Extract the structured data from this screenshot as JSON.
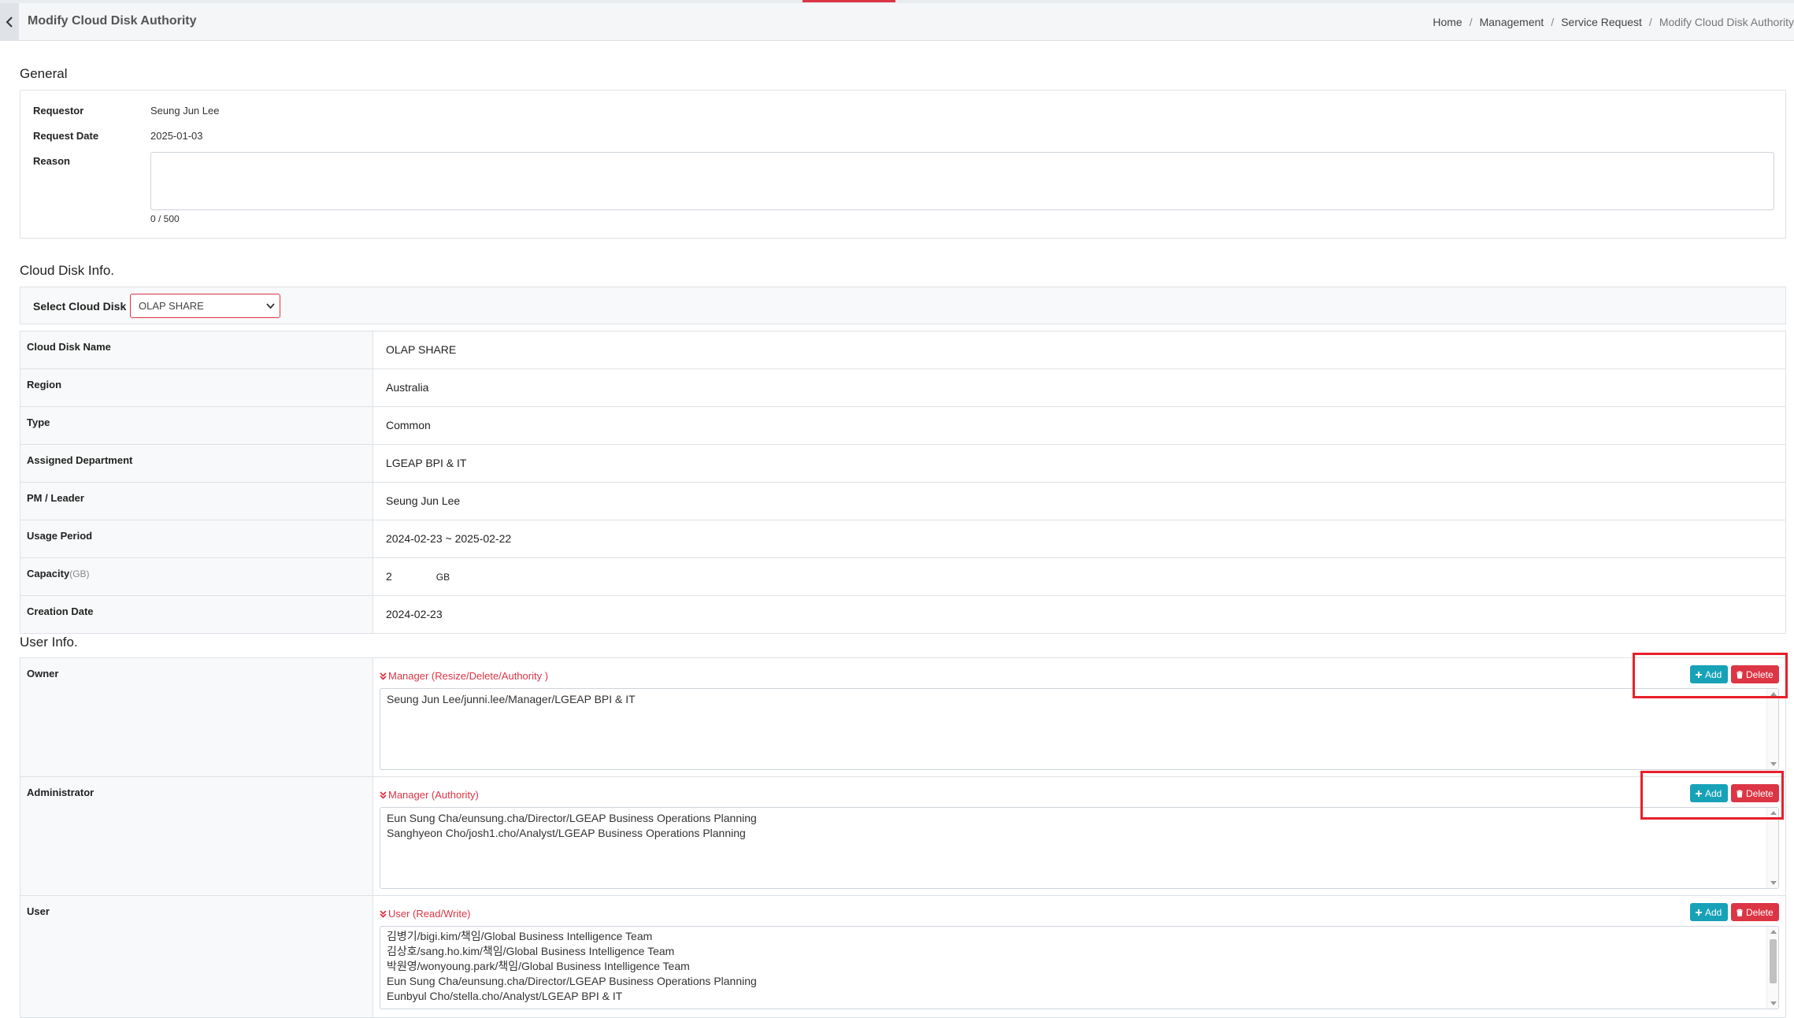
{
  "header": {
    "title": "Modify Cloud Disk Authority",
    "breadcrumb": [
      "Home",
      "Management",
      "Service Request",
      "Modify Cloud Disk Authority"
    ]
  },
  "general": {
    "section_title": "General",
    "requestor_label": "Requestor",
    "requestor_value": "Seung Jun Lee",
    "request_date_label": "Request Date",
    "request_date_value": "2025-01-03",
    "reason_label": "Reason",
    "reason_value": "",
    "reason_counter": "0 / 500"
  },
  "disk": {
    "section_title": "Cloud Disk Info.",
    "select_label": "Select Cloud Disk",
    "selected": "OLAP SHARE",
    "rows": [
      {
        "label": "Cloud Disk Name",
        "value": "OLAP SHARE"
      },
      {
        "label": "Region",
        "value": "Australia"
      },
      {
        "label": "Type",
        "value": "Common"
      },
      {
        "label": "Assigned Department",
        "value": "LGEAP BPI & IT"
      },
      {
        "label": "PM / Leader",
        "value": "Seung Jun Lee"
      },
      {
        "label": "Usage Period",
        "value": "2024-02-23 ~ 2025-02-22"
      },
      {
        "label": "Capacity",
        "label_unit": "(GB)",
        "value": "2",
        "unit": "GB"
      },
      {
        "label": "Creation Date",
        "value": "2024-02-23"
      }
    ]
  },
  "users": {
    "section_title": "User Info.",
    "add_label": "Add",
    "delete_label": "Delete",
    "owner": {
      "label": "Owner",
      "role": "Manager (Resize/Delete/Authority )",
      "entries": [
        "Seung Jun Lee/junni.lee/Manager/LGEAP BPI & IT"
      ]
    },
    "administrator": {
      "label": "Administrator",
      "role": "Manager (Authority)",
      "entries": [
        "Eun Sung Cha/eunsung.cha/Director/LGEAP Business Operations Planning",
        "Sanghyeon Cho/josh1.cho/Analyst/LGEAP Business Operations Planning"
      ]
    },
    "user": {
      "label": "User",
      "role": "User (Read/Write)",
      "entries": [
        "김병기/bigi.kim/책임/Global Business Intelligence Team",
        "김상호/sang.ho.kim/책임/Global Business Intelligence Team",
        "박원영/wonyoung.park/책임/Global Business Intelligence Team",
        "Eun Sung Cha/eunsung.cha/Director/LGEAP Business Operations Planning",
        "Eunbyul Cho/stella.cho/Analyst/LGEAP BPI & IT"
      ]
    }
  },
  "colors": {
    "accent_red": "#dc3545",
    "add_button": "#17a2b8",
    "highlight": "#e8202a"
  }
}
